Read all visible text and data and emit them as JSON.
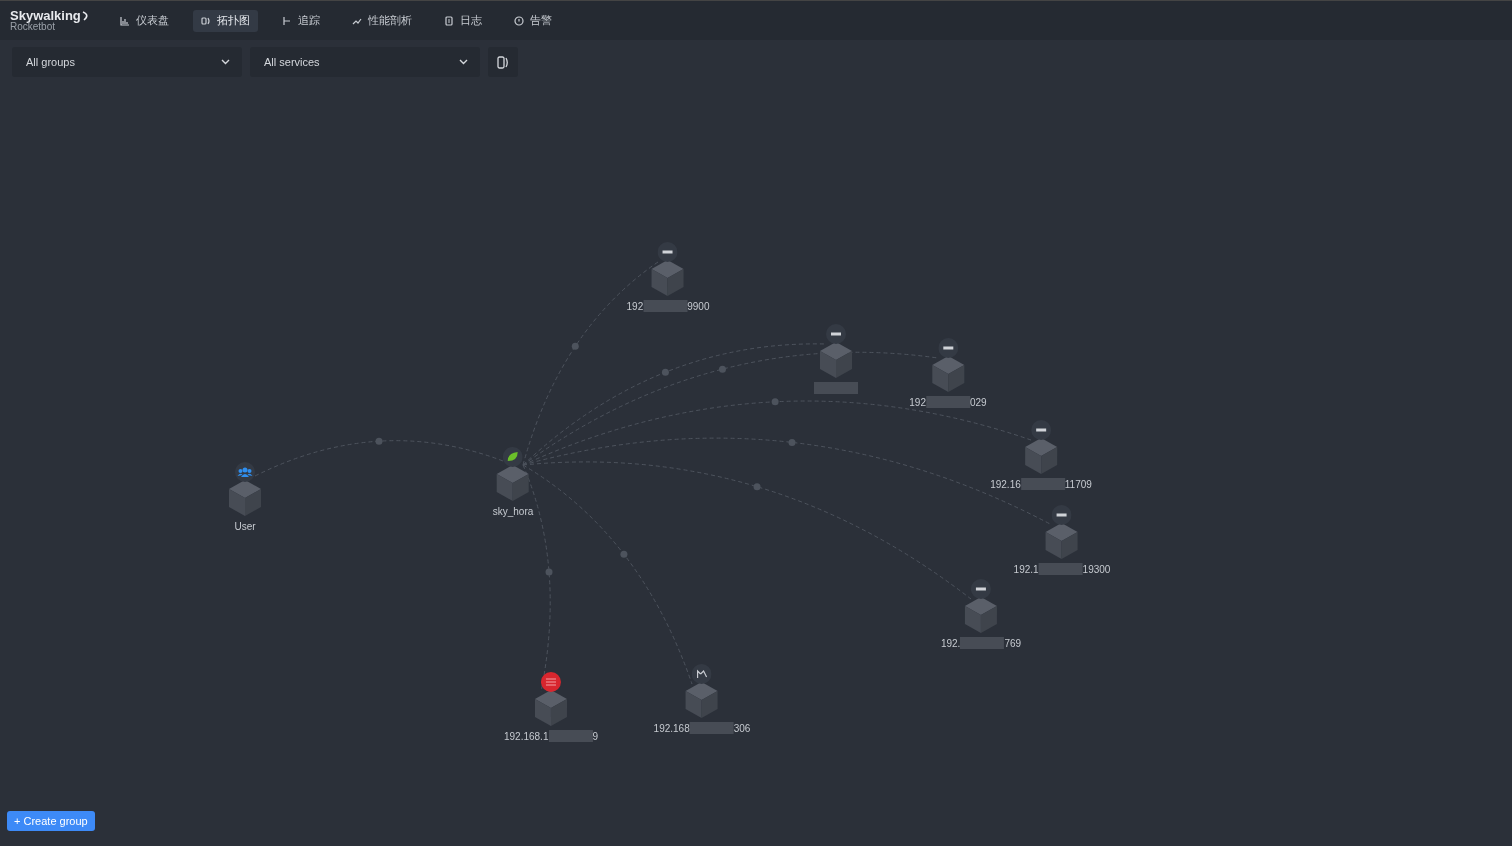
{
  "logo": {
    "title": "Skywalking",
    "subtitle": "Rocketbot"
  },
  "nav": [
    {
      "label": "仪表盘",
      "kind": "dashboard",
      "selected": false
    },
    {
      "label": "拓扑图",
      "kind": "topology",
      "selected": true
    },
    {
      "label": "追踪",
      "kind": "trace",
      "selected": false
    },
    {
      "label": "性能剖析",
      "kind": "profile",
      "selected": false
    },
    {
      "label": "日志",
      "kind": "log",
      "selected": false
    },
    {
      "label": "告警",
      "kind": "alarm",
      "selected": false
    }
  ],
  "filters": [
    {
      "value": "All groups"
    },
    {
      "value": "All services"
    }
  ],
  "nodes": [
    {
      "kind": "user",
      "label": [
        "User"
      ],
      "redacted": false
    },
    {
      "kind": "spring",
      "label": [
        "sky_hora"
      ],
      "redacted": false
    },
    {
      "kind": "http",
      "label": [
        "192",
        "9900"
      ],
      "redacted": true
    },
    {
      "kind": "http",
      "redacted": true
    },
    {
      "kind": "http",
      "label": [
        "192",
        "029"
      ],
      "redacted": true
    },
    {
      "kind": "http",
      "label": [
        "192.16",
        "11709"
      ],
      "redacted": true
    },
    {
      "kind": "http",
      "label": [
        "192.1",
        "19300"
      ],
      "redacted": true
    },
    {
      "kind": "http",
      "label": [
        "192.",
        "769"
      ],
      "redacted": true
    },
    {
      "kind": "redis",
      "label": [
        "192.168.1",
        "9"
      ],
      "redacted": true
    },
    {
      "kind": "mq",
      "label": [
        "192.168",
        "306"
      ],
      "redacted": true
    }
  ],
  "create_button": "+ Create group"
}
